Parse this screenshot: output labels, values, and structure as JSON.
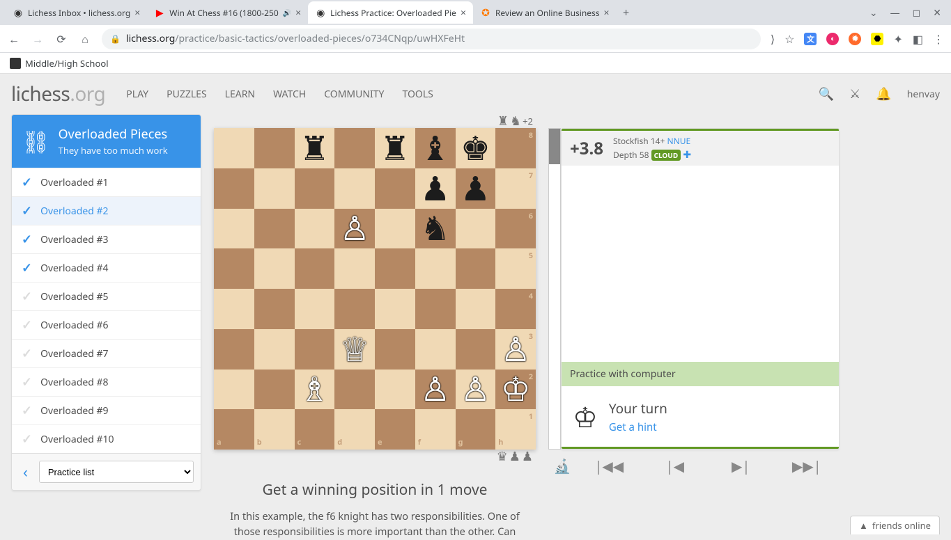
{
  "browser": {
    "tabs": [
      {
        "title": "Lichess Inbox • lichess.org",
        "favicon": "◉",
        "audio": false,
        "active": false
      },
      {
        "title": "Win At Chess #16 (1800-250",
        "favicon": "▶",
        "audio": true,
        "active": false
      },
      {
        "title": "Lichess Practice: Overloaded Pie",
        "favicon": "◉",
        "audio": false,
        "active": true
      },
      {
        "title": "Review an Online Business",
        "favicon": "✪",
        "audio": false,
        "active": false
      }
    ],
    "url_domain": "lichess.org",
    "url_path": "/practice/basic-tactics/overloaded-pieces/o734CNqp/uwHXFeHt",
    "bookmark": "Middle/High School"
  },
  "header": {
    "logo_main": "lichess",
    "logo_suffix": ".org",
    "nav": [
      "PLAY",
      "PUZZLES",
      "LEARN",
      "WATCH",
      "COMMUNITY",
      "TOOLS"
    ],
    "username": "henvay"
  },
  "sidebar": {
    "title": "Overloaded Pieces",
    "subtitle": "They have too much work",
    "chapters": [
      {
        "label": "Overloaded #1",
        "done": true,
        "active": false
      },
      {
        "label": "Overloaded #2",
        "done": true,
        "active": true
      },
      {
        "label": "Overloaded #3",
        "done": true,
        "active": false
      },
      {
        "label": "Overloaded #4",
        "done": true,
        "active": false
      },
      {
        "label": "Overloaded #5",
        "done": false,
        "active": false
      },
      {
        "label": "Overloaded #6",
        "done": false,
        "active": false
      },
      {
        "label": "Overloaded #7",
        "done": false,
        "active": false
      },
      {
        "label": "Overloaded #8",
        "done": false,
        "active": false
      },
      {
        "label": "Overloaded #9",
        "done": false,
        "active": false
      },
      {
        "label": "Overloaded #10",
        "done": false,
        "active": false
      }
    ],
    "select_label": "Practice list"
  },
  "material": {
    "top_score": "+2"
  },
  "board": {
    "files": [
      "a",
      "b",
      "c",
      "d",
      "e",
      "f",
      "g",
      "h"
    ],
    "ranks": [
      "8",
      "7",
      "6",
      "5",
      "4",
      "3",
      "2",
      "1"
    ],
    "pieces": [
      {
        "sq": "c8",
        "glyph": "♜",
        "color": "black",
        "name": "black-rook"
      },
      {
        "sq": "e8",
        "glyph": "♜",
        "color": "black",
        "name": "black-rook"
      },
      {
        "sq": "f8",
        "glyph": "♝",
        "color": "black",
        "name": "black-bishop"
      },
      {
        "sq": "g8",
        "glyph": "♚",
        "color": "black",
        "name": "black-king"
      },
      {
        "sq": "f7",
        "glyph": "♟",
        "color": "black",
        "name": "black-pawn"
      },
      {
        "sq": "g7",
        "glyph": "♟",
        "color": "black",
        "name": "black-pawn"
      },
      {
        "sq": "d6",
        "glyph": "♙",
        "color": "white",
        "name": "white-pawn"
      },
      {
        "sq": "f6",
        "glyph": "♞",
        "color": "black",
        "name": "black-knight"
      },
      {
        "sq": "d3",
        "glyph": "♕",
        "color": "white",
        "name": "white-queen"
      },
      {
        "sq": "h3",
        "glyph": "♙",
        "color": "white",
        "name": "white-pawn"
      },
      {
        "sq": "c2",
        "glyph": "♗",
        "color": "white",
        "name": "white-bishop"
      },
      {
        "sq": "f2",
        "glyph": "♙",
        "color": "white",
        "name": "white-pawn"
      },
      {
        "sq": "g2",
        "glyph": "♙",
        "color": "white",
        "name": "white-pawn"
      },
      {
        "sq": "h2",
        "glyph": "♔",
        "color": "white",
        "name": "white-king"
      }
    ]
  },
  "instruction": {
    "title": "Get a winning position in 1 move",
    "body": "In this example, the f6 knight has two responsibilities. One of those responsibilities is more important than the other. Can"
  },
  "analysis": {
    "score": "+3.8",
    "engine": "Stockfish 14+",
    "nnue": "NNUE",
    "depth_label": "Depth 58",
    "cloud": "CLOUD",
    "practice_label": "Practice with computer",
    "your_turn": "Your turn",
    "hint": "Get a hint",
    "gauge_black_pct": 11
  },
  "friends": "friends online"
}
